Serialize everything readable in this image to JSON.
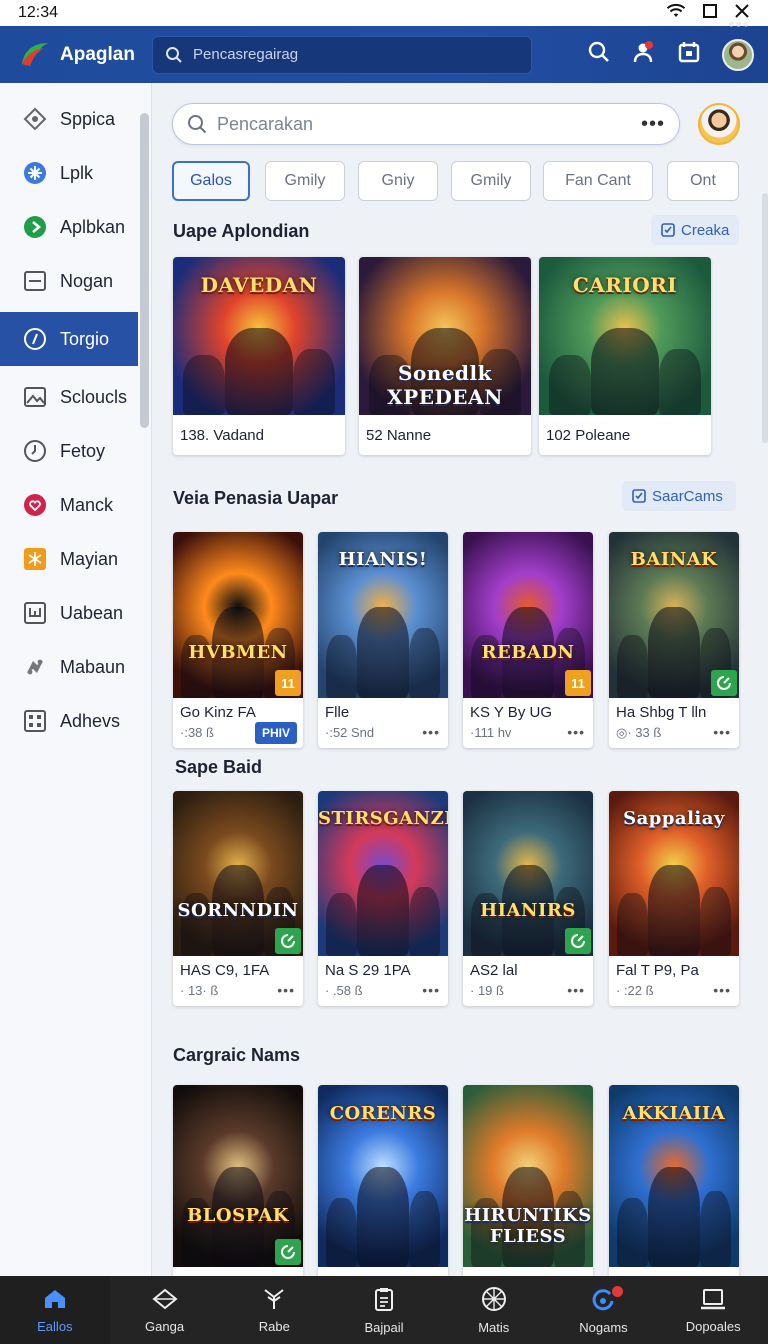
{
  "status": {
    "time": "12:34"
  },
  "app": {
    "title": "Apaglan",
    "search_placeholder": "Pencasregairag"
  },
  "sidebar": {
    "items": [
      {
        "label": "Sppica",
        "icon": "diamond-icon"
      },
      {
        "label": "Lplk",
        "icon": "sparkle-icon"
      },
      {
        "label": "Aplbkan",
        "icon": "play-arrow-icon"
      },
      {
        "label": "Nogan",
        "icon": "window-icon"
      },
      {
        "label": "Torgio",
        "icon": "compass-icon",
        "active": true
      },
      {
        "label": "Scloucls",
        "icon": "image-icon"
      },
      {
        "label": "Fetoy",
        "icon": "clock-icon"
      },
      {
        "label": "Manck",
        "icon": "heart-badge-icon"
      },
      {
        "label": "Mayian",
        "icon": "grid-badge-icon"
      },
      {
        "label": "Uabean",
        "icon": "chart-box-icon"
      },
      {
        "label": "Mabaun",
        "icon": "gamepad-icon"
      },
      {
        "label": "Adhevs",
        "icon": "apps-icon"
      }
    ]
  },
  "main": {
    "search_placeholder": "Pencarakan",
    "chips": [
      "Galos",
      "Gmily",
      "Gniy",
      "Gmily",
      "Fan Cant",
      "Ont"
    ],
    "sections": [
      {
        "title": "Uape Aplondian",
        "button": "Creaka"
      },
      {
        "title": "Veia Penasia Uapar",
        "button": "SaarCams"
      },
      {
        "title": "Sape Baid"
      },
      {
        "title": "Cargraic Nams"
      }
    ],
    "row1": [
      {
        "art": "DAVEDAN",
        "caption": "138. Vadand"
      },
      {
        "art": "Sonedlk XPEDEAN",
        "caption": "52 Nanne"
      },
      {
        "art": "CARIORI",
        "caption": "102 Poleane"
      }
    ],
    "row2": [
      {
        "art": "HVBMEN",
        "caption": "Go Kinz FA",
        "meta": "·:38 ß",
        "tag": "PHIV",
        "badge": "11"
      },
      {
        "art": "HIANIS!",
        "caption": "Flle",
        "meta": "·:52 Snd"
      },
      {
        "art": "REBADN",
        "caption": "KS Y By UG",
        "meta": "·111 hv",
        "badge": "11"
      },
      {
        "art": "BAINAK",
        "caption": "Ha Shbg T lln",
        "meta": "◎· 33 ß"
      }
    ],
    "row3": [
      {
        "art": "SORNNDIN",
        "caption": "HAS C9, 1FA",
        "meta": "· 13· ß"
      },
      {
        "art": "STIRSGANZE",
        "caption": "Na S 29 1PA",
        "meta": "· .58 ß"
      },
      {
        "art": "HIANIRS",
        "caption": "AS2 lal",
        "meta": "· 19 ß"
      },
      {
        "art": "Sappaliay",
        "caption": "Fal T P9, Pa",
        "meta": "· :22 ß"
      }
    ],
    "row4": [
      {
        "art": "BLOSPAK"
      },
      {
        "art": "CORENRS"
      },
      {
        "art": "HIRUNTIKS FLIESS"
      },
      {
        "art": "AKKIAIIA"
      }
    ]
  },
  "bottom_nav": [
    {
      "label": "Eallos",
      "icon": "home-icon",
      "active": true
    },
    {
      "label": "Ganga",
      "icon": "diamond-outline-icon"
    },
    {
      "label": "Rabe",
      "icon": "tree-icon"
    },
    {
      "label": "Bajpail",
      "icon": "clipboard-icon"
    },
    {
      "label": "Matis",
      "icon": "target-icon"
    },
    {
      "label": "Nogams",
      "icon": "notification-icon",
      "dot": true
    },
    {
      "label": "Dopoales",
      "icon": "laptop-icon"
    }
  ]
}
